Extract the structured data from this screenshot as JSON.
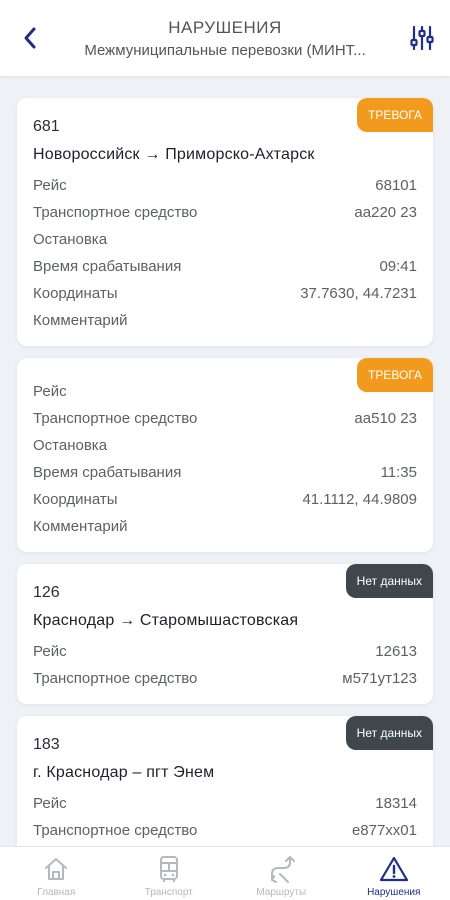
{
  "header": {
    "title": "НАРУШЕНИЯ",
    "subtitle": "Межмуниципальные перевозки (МИНТ..."
  },
  "colors": {
    "accent": "#1d2e86",
    "alarm_badge": "#f19a1d",
    "nodata_badge": "#3f474d"
  },
  "cards": [
    {
      "badge": "ТРЕВОГА",
      "number": "681",
      "route": "Новороссийск → Приморско-Ахтарск",
      "rows": [
        {
          "label": "Рейс",
          "value": "68101"
        },
        {
          "label": "Транспортное средство",
          "value": "аа220 23"
        },
        {
          "label": "Остановка",
          "value": ""
        },
        {
          "label": "Время срабатывания",
          "value": "09:41"
        },
        {
          "label": "Координаты",
          "value": "37.7630, 44.7231"
        },
        {
          "label": "Комментарий",
          "value": ""
        }
      ]
    },
    {
      "badge": "ТРЕВОГА",
      "rows": [
        {
          "label": "Рейс",
          "value": ""
        },
        {
          "label": "Транспортное средство",
          "value": "аа510 23"
        },
        {
          "label": "Остановка",
          "value": ""
        },
        {
          "label": "Время срабатывания",
          "value": "11:35"
        },
        {
          "label": "Координаты",
          "value": "41.1112, 44.9809"
        },
        {
          "label": "Комментарий",
          "value": ""
        }
      ]
    },
    {
      "badge": "Нет данных",
      "number": "126",
      "route": "Краснодар → Старомышастовская",
      "rows": [
        {
          "label": "Рейс",
          "value": "12613"
        },
        {
          "label": "Транспортное средство",
          "value": "м571ут123"
        }
      ]
    },
    {
      "badge": "Нет данных",
      "number": "183",
      "route": "г. Краснодар – пгт Энем",
      "rows": [
        {
          "label": "Рейс",
          "value": "18314"
        },
        {
          "label": "Транспортное средство",
          "value": "е877хх01"
        }
      ]
    }
  ],
  "tabbar": {
    "items": [
      {
        "label": "Главная",
        "icon": "home-icon"
      },
      {
        "label": "Транспорт",
        "icon": "bus-icon"
      },
      {
        "label": "Маршруты",
        "icon": "routes-icon"
      },
      {
        "label": "Нарушения",
        "icon": "warning-icon",
        "active": true
      }
    ]
  }
}
